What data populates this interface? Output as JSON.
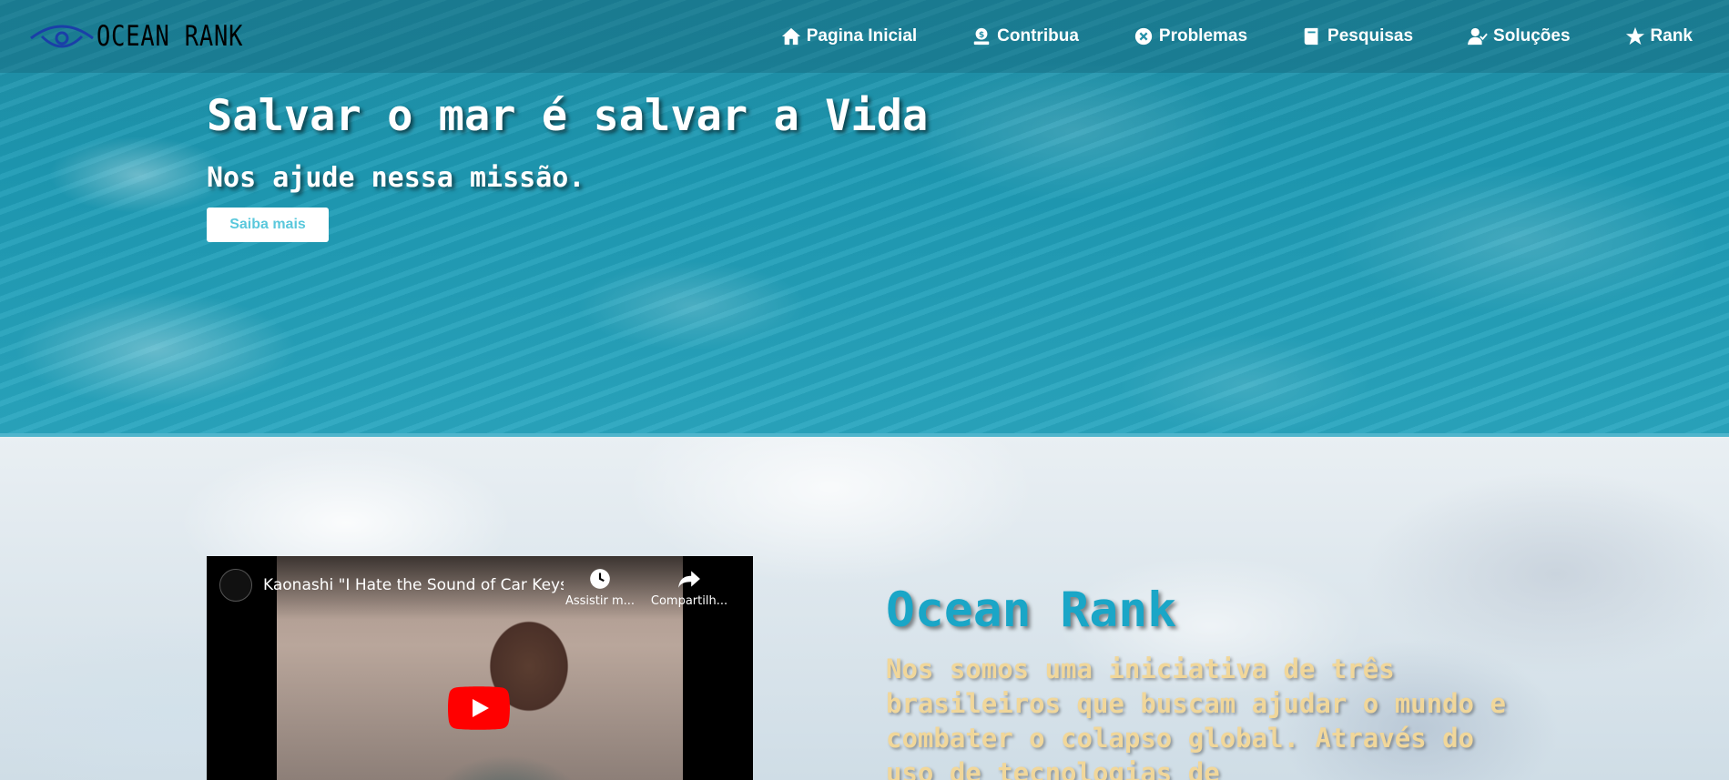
{
  "brand": {
    "name": "OCEAN RANK"
  },
  "nav": {
    "items": [
      {
        "label": "Pagina Inicial",
        "icon": "home-icon"
      },
      {
        "label": "Contribua",
        "icon": "donate-icon"
      },
      {
        "label": "Problemas",
        "icon": "close-circle-icon"
      },
      {
        "label": "Pesquisas",
        "icon": "book-icon"
      },
      {
        "label": "Soluções",
        "icon": "user-check-icon"
      },
      {
        "label": "Rank",
        "icon": "star-icon"
      }
    ]
  },
  "hero": {
    "title": "Salvar o mar é salvar a Vida",
    "subtitle": "Nos ajude nessa missão.",
    "cta_label": "Saiba mais"
  },
  "video": {
    "title": "Kaonashi \"I Hate the Sound of Car Keys...",
    "watch_later_label": "Assistir m...",
    "share_label": "Compartilh..."
  },
  "about": {
    "title": "Ocean Rank",
    "body": "Nos somos uma iniciativa de três brasileiros que buscam ajudar o mundo e combater o colapso global. Através do uso de tecnologias de"
  },
  "colors": {
    "hero_water": "#1e9bb5",
    "about_title": "#1aa6c7",
    "about_body": "#f1d79a",
    "cta_text": "#5ac8dc",
    "play_red": "#ff0000"
  }
}
